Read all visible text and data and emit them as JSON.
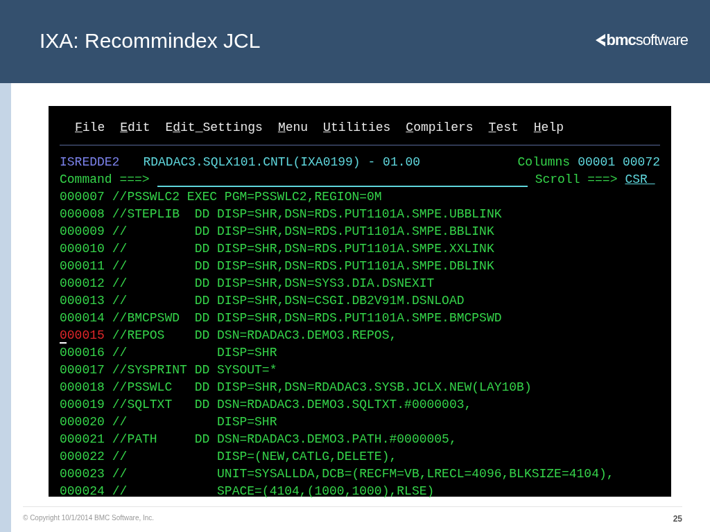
{
  "slide": {
    "title": "IXA: Recommindex JCL",
    "logo": {
      "bold": "bmc",
      "rest": "software"
    }
  },
  "terminal": {
    "menu": [
      {
        "key": "F",
        "post": "ile"
      },
      {
        "key": "E",
        "post": "dit"
      },
      {
        "pre": "E",
        "key": "d",
        "post": "it_Settings"
      },
      {
        "key": "M",
        "post": "enu"
      },
      {
        "key": "U",
        "post": "tilities"
      },
      {
        "key": "C",
        "post": "ompilers"
      },
      {
        "key": "T",
        "post": "est"
      },
      {
        "key": "H",
        "post": "elp"
      }
    ],
    "panel_id": "ISREDDE2",
    "dataset": "RDADAC3.SQLX101.CNTL(IXA0199) - 01.00",
    "columns_label": "Columns",
    "columns": "00001 00072",
    "command_label": "Command ===>",
    "scroll_label": "Scroll ===>",
    "scroll_value": "CSR",
    "lines": [
      {
        "number": "000007",
        "text": "//PSSWLC2 EXEC PGM=PSSWLC2,REGION=0M",
        "current": false
      },
      {
        "number": "000008",
        "text": "//STEPLIB  DD DISP=SHR,DSN=RDS.PUT1101A.SMPE.UBBLINK",
        "current": false
      },
      {
        "number": "000009",
        "text": "//         DD DISP=SHR,DSN=RDS.PUT1101A.SMPE.BBLINK",
        "current": false
      },
      {
        "number": "000010",
        "text": "//         DD DISP=SHR,DSN=RDS.PUT1101A.SMPE.XXLINK",
        "current": false
      },
      {
        "number": "000011",
        "text": "//         DD DISP=SHR,DSN=RDS.PUT1101A.SMPE.DBLINK",
        "current": false
      },
      {
        "number": "000012",
        "text": "//         DD DISP=SHR,DSN=SYS3.DIA.DSNEXIT",
        "current": false
      },
      {
        "number": "000013",
        "text": "//         DD DISP=SHR,DSN=CSGI.DB2V91M.DSNLOAD",
        "current": false
      },
      {
        "number": "000014",
        "text": "//BMCPSWD  DD DISP=SHR,DSN=RDS.PUT1101A.SMPE.BMCPSWD",
        "current": false
      },
      {
        "number": "000015",
        "text": "//REPOS    DD DSN=RDADAC3.DEMO3.REPOS,",
        "current": true
      },
      {
        "number": "000016",
        "text": "//            DISP=SHR",
        "current": false
      },
      {
        "number": "000017",
        "text": "//SYSPRINT DD SYSOUT=*",
        "current": false
      },
      {
        "number": "000018",
        "text": "//PSSWLC   DD DISP=SHR,DSN=RDADAC3.SYSB.JCLX.NEW(LAY10B)",
        "current": false
      },
      {
        "number": "000019",
        "text": "//SQLTXT   DD DSN=RDADAC3.DEMO3.SQLTXT.#0000003,",
        "current": false
      },
      {
        "number": "000020",
        "text": "//            DISP=SHR",
        "current": false
      },
      {
        "number": "000021",
        "text": "//PATH     DD DSN=RDADAC3.DEMO3.PATH.#0000005,",
        "current": false
      },
      {
        "number": "000022",
        "text": "//            DISP=(NEW,CATLG,DELETE),",
        "current": false
      },
      {
        "number": "000023",
        "text": "//            UNIT=SYSALLDA,DCB=(RECFM=VB,LRECL=4096,BLKSIZE=4104),",
        "current": false
      },
      {
        "number": "000024",
        "text": "//            SPACE=(4104,(1000,1000),RLSE)",
        "current": false
      }
    ]
  },
  "footer": {
    "copyright": "© Copyright 10/1/2014 BMC Software, Inc.",
    "page": "25"
  }
}
